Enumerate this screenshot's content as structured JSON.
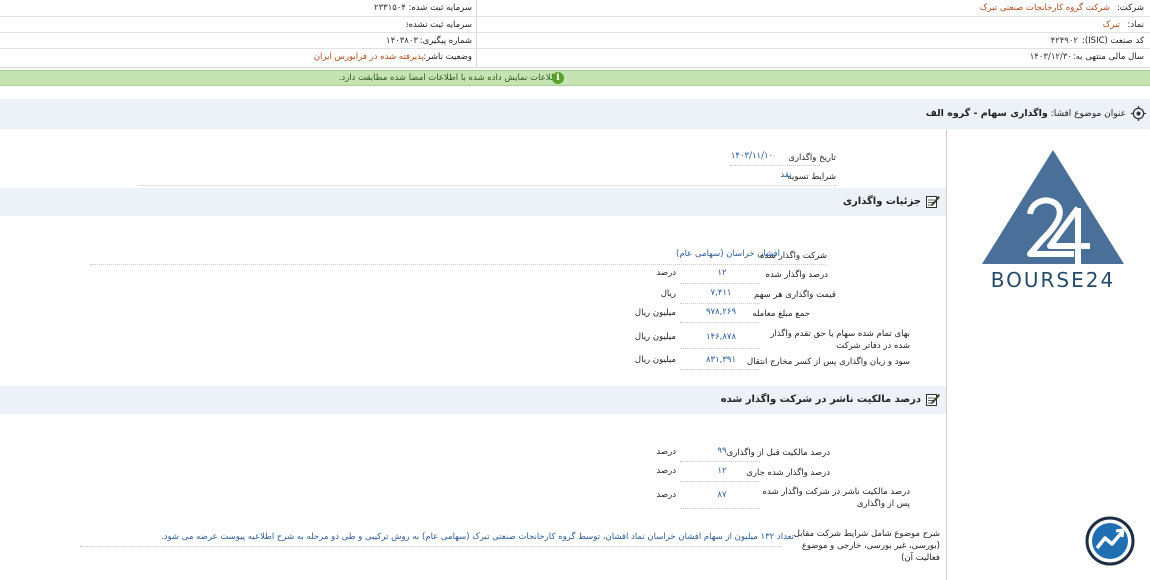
{
  "header": {
    "company_label": "شرکت:",
    "company_value": "شرکت گروه کارخانجات صنعتی تبرک",
    "symbol_label": "نماد:",
    "symbol_value": "تبرک",
    "isic_label": "کد صنعت (ISIC):",
    "isic_value": "۴۲۴۹۰۲",
    "fiscal_label": "سال مالی منتهی به:",
    "fiscal_value": "۱۴۰۳/۱۲/۳۰",
    "registered_capital_label": "سرمایه ثبت شده:",
    "registered_capital_value": "۲۳۳۱۵۰۴",
    "unregistered_capital_label": "سرمایه ثبت نشده:",
    "unregistered_capital_value": "۰",
    "tracking_label": "شماره پیگیری:",
    "tracking_value": "۱۴۰۳۸۰۳",
    "publisher_status_label": "وضعیت ناشر:",
    "publisher_status_value": "پذیرفته شده در فرابورس ایران"
  },
  "notice": {
    "text": "اطلاعات نمایش داده شده با اطلاعات امضا شده مطابقت دارد.",
    "icon": "info-icon"
  },
  "subject": {
    "label": "عنوان موضوع افشا:",
    "value": "واگذاری سهام - گروه الف"
  },
  "transfer": {
    "date_label": "تاریخ واگذاری",
    "date_value": "۱۴۰۳/۱۱/۱۰",
    "settlement_label": "شرایط تسویه",
    "settlement_value": "نقد"
  },
  "details": {
    "title": "جزئیات واگذاری",
    "company_label": "شرکت واگذار شده",
    "company_value": "افشان خراسان (سهامی عام)",
    "percent_label": "درصد واگذار شده",
    "percent_value": "۱۲",
    "percent_unit": "درصد",
    "price_label": "قیمت واگذاری هر سهم",
    "price_value": "۷,۴۱۱",
    "price_unit": "ریال",
    "total_label": "جمع مبلغ معامله",
    "total_value": "۹۷۸,۲۶۹",
    "total_unit": "میلیون ریال",
    "book_label": "بهای تمام شده سهام یا حق تقدم واگذار شده در دفاتر شرکت",
    "book_value": "۱۴۶,۸۷۸",
    "book_unit": "میلیون ریال",
    "profit_label": "سود و زیان واگذاری پس از کسر مخارج انتقال",
    "profit_value": "۸۳۱,۳۹۱",
    "profit_unit": "میلیون ریال"
  },
  "ownership": {
    "title": "درصد مالکیت ناشر در شرکت واگذار شده",
    "before_label": "درصد مالکیت قبل از واگذاری",
    "before_value": "۹۹",
    "before_unit": "درصد",
    "current_label": "درصد واگذار شده جاری",
    "current_value": "۱۲",
    "current_unit": "درصد",
    "after_label": "درصد مالکیت ناشر در شرکت واگذار شده پس از واگذاری",
    "after_value": "۸۷",
    "after_unit": "درصد",
    "desc_label": "شرح موضوع شامل شرایط شرکت مقابل (بورسی، غیر بورسی، خارجی و موضوع فعالیت آن)",
    "desc_line1": "تعداد ۱۳۲ میلیون از سهام افشان خراسان نماد افشان، توسط گروه کارخانجات صنعتی تبرک (سهامی عام) به روش ترکیبی و طی دو مرحله به شرح اطلاعیه پیوست عرضه می شود."
  },
  "branding": {
    "logo_text": "BOURSE24",
    "logo_icon": "bourse24-logo",
    "chart_icon": "trend-chart-icon"
  },
  "colors": {
    "orange_value": "#b04a1a",
    "blue_value": "#2b5d97",
    "notice_bg": "#c5e3b3",
    "section_bg": "#edf2f8",
    "logo_blue": "#4a7099"
  }
}
